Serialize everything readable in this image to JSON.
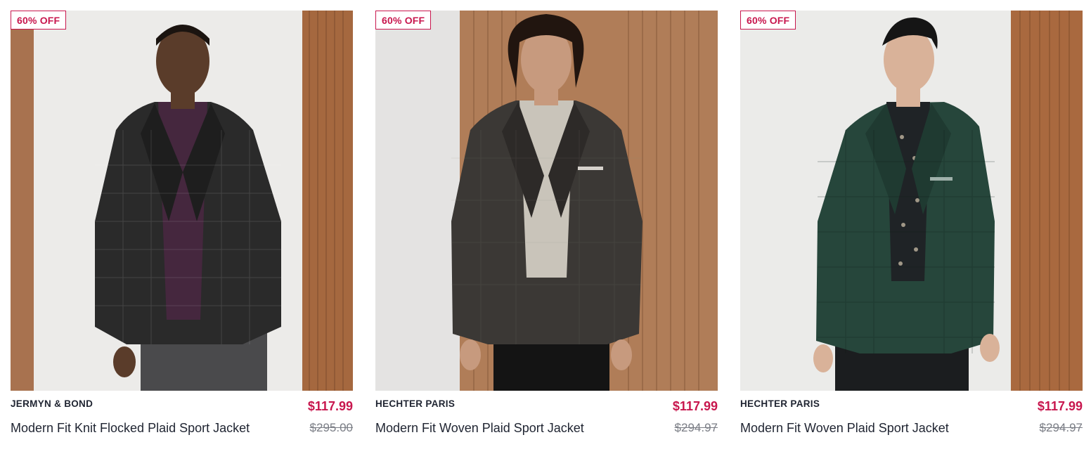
{
  "colors": {
    "accent": "#c8174e",
    "text": "#1f2431",
    "muted": "#7a7d85"
  },
  "products": [
    {
      "badge": "60% OFF",
      "brand": "JERMYN & BOND",
      "title": "Modern Fit Knit Flocked Plaid Sport Jacket",
      "sale_price": "$117.99",
      "original_price": "$295.00",
      "jacket_color": "#2a2a2a",
      "inner_color": "#45273e",
      "skin_color": "#5a3c2a"
    },
    {
      "badge": "60% OFF",
      "brand": "HECHTER PARIS",
      "title": "Modern Fit Woven Plaid Sport Jacket",
      "sale_price": "$117.99",
      "original_price": "$294.97",
      "jacket_color": "#3b3835",
      "inner_color": "#c9c4ba",
      "skin_color": "#c79a7e"
    },
    {
      "badge": "60% OFF",
      "brand": "HECHTER PARIS",
      "title": "Modern Fit Woven Plaid Sport Jacket",
      "sale_price": "$117.99",
      "original_price": "$294.97",
      "jacket_color": "#26463b",
      "inner_color": "#1f2326",
      "skin_color": "#d9b299"
    }
  ]
}
